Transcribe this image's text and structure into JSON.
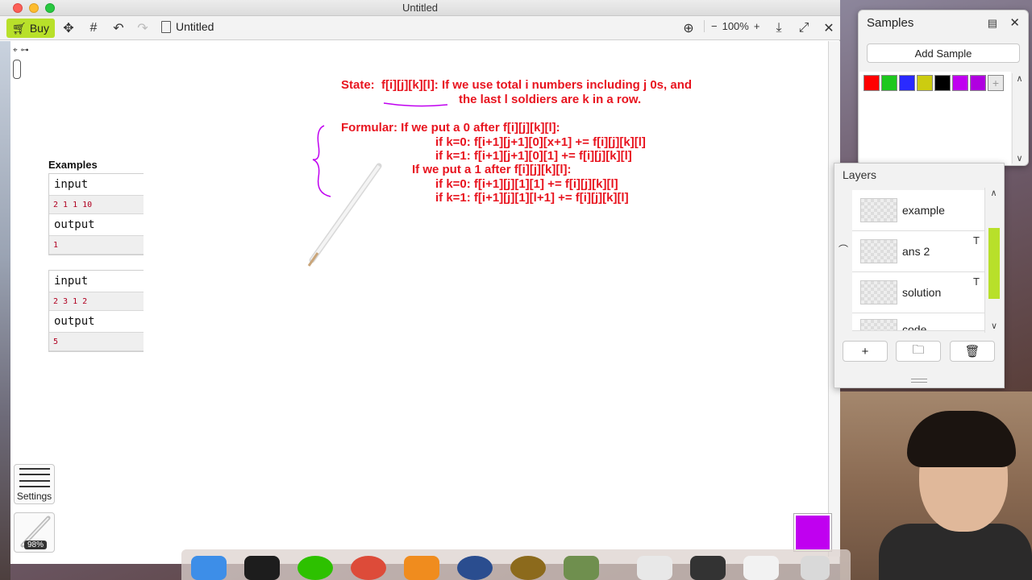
{
  "window": {
    "title": "Untitled"
  },
  "toolbar": {
    "buy_label": "Buy",
    "doc_title": "Untitled",
    "zoom": "100%",
    "zoom_minus": "−",
    "zoom_plus": "+"
  },
  "examples": {
    "title": "Examples",
    "items": [
      {
        "input_label": "input",
        "input_value": "2 1 1 10",
        "output_label": "output",
        "output_value": "1"
      },
      {
        "input_label": "input",
        "input_value": "2 3 1 2",
        "output_label": "output",
        "output_value": "5"
      }
    ]
  },
  "notes": {
    "state_line1": "State:  f[i][j][k][l]: If we use total i numbers including j 0s, and",
    "state_line2": "the last l soldiers are k in a row.",
    "formular_line1": "Formular: If we put a 0 after f[i][j][k][l]:",
    "formular_line2": "if k=0: f[i+1][j+1][0][x+1] += f[i][j][k][l]",
    "formular_line3": "if k=1: f[i+1][j+1][0][1] += f[i][j][k][l]",
    "formular_line4": "If we put a 1 after f[i][j][k][l]:",
    "formular_line5": "if k=0: f[i+1][j][1][1] += f[i][j][k][l]",
    "formular_line6": "if k=1: f[i+1][j][1][l+1] += f[i][j][k][l]"
  },
  "left_tools": {
    "settings_label": "Settings",
    "brush_percent": "98%"
  },
  "current_color": "#c000f0",
  "samples": {
    "title": "Samples",
    "add_label": "Add Sample",
    "palette": [
      "#ff0000",
      "#1ec81e",
      "#2a2aff",
      "#cccc10",
      "#000000",
      "#c000f0",
      "#b000e0"
    ]
  },
  "layers": {
    "title": "Layers",
    "items": [
      {
        "name": "example",
        "visible": false,
        "text": false
      },
      {
        "name": "ans 2",
        "visible": true,
        "text": true
      },
      {
        "name": "solution",
        "visible": false,
        "text": true
      },
      {
        "name": "code",
        "visible": true,
        "text": false
      }
    ],
    "add_label": "+"
  },
  "icons": {
    "settings": "settings-icon",
    "brush": "pencil-icon",
    "folder": "folder-icon",
    "trash": "trash-icon"
  }
}
